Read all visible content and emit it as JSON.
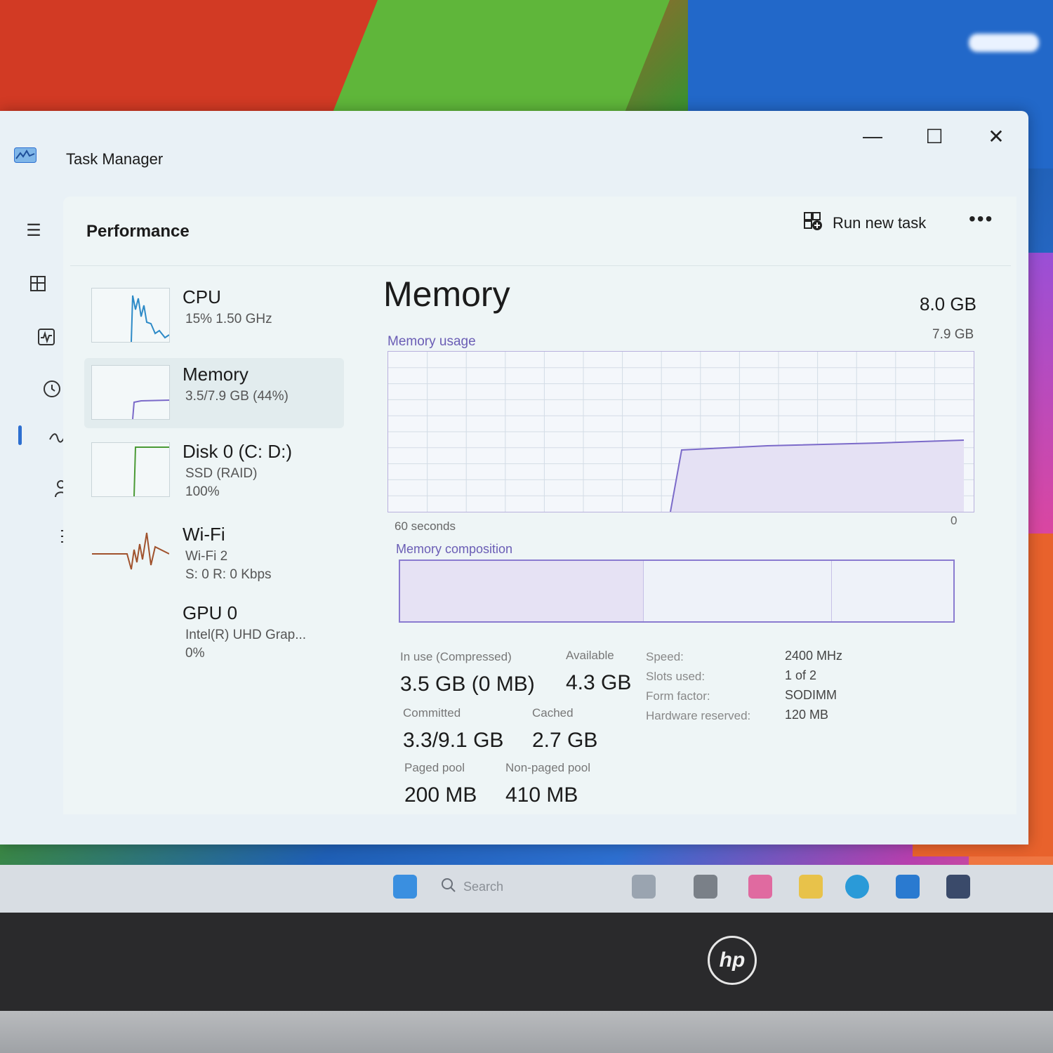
{
  "window": {
    "title": "Task Manager",
    "controls": {
      "minimize": "—",
      "maximize": "☐",
      "close": "✕"
    }
  },
  "header": {
    "title": "Performance",
    "run_task_label": "Run new task",
    "more_label": "•••"
  },
  "nav": {
    "items": [
      "hamburger-menu-icon",
      "processes-icon",
      "performance-icon",
      "app-history-icon",
      "startup-apps-icon",
      "users-icon",
      "details-icon",
      "services-icon"
    ]
  },
  "resources": [
    {
      "name": "CPU",
      "line1": "15% 1.50 GHz",
      "line2": "",
      "line3": "",
      "color": "#2d8ac7"
    },
    {
      "name": "Memory",
      "line1": "3.5/7.9 GB (44%)",
      "line2": "",
      "line3": "",
      "color": "#7b6ac9"
    },
    {
      "name": "Disk 0 (C: D:)",
      "line1": "SSD (RAID)",
      "line2": "100%",
      "line3": "",
      "color": "#4a9a35"
    },
    {
      "name": "Wi-Fi",
      "line1": "Wi-Fi 2",
      "line2": "S: 0 R: 0 Kbps",
      "line3": "",
      "color": "#a0522d"
    },
    {
      "name": "GPU 0",
      "line1": "Intel(R) UHD Grap...",
      "line2": "0%",
      "line3": "",
      "color": "#2d8ac7"
    }
  ],
  "memory": {
    "title": "Memory",
    "total": "8.0 GB",
    "usage_label": "Memory usage",
    "max_label": "7.9 GB",
    "time_left": "60 seconds",
    "time_right": "0",
    "composition_label": "Memory composition",
    "composition": [
      0.44,
      0.34,
      0.22
    ],
    "line_color": "#7b6ac9",
    "stats": {
      "in_use_label": "In use (Compressed)",
      "in_use_value": "3.5 GB (0 MB)",
      "available_label": "Available",
      "available_value": "4.3 GB",
      "committed_label": "Committed",
      "committed_value": "3.3/9.1 GB",
      "cached_label": "Cached",
      "cached_value": "2.7 GB",
      "paged_label": "Paged pool",
      "paged_value": "200 MB",
      "nonpaged_label": "Non-paged pool",
      "nonpaged_value": "410 MB"
    },
    "specs": [
      {
        "label": "Speed:",
        "value": "2400 MHz"
      },
      {
        "label": "Slots used:",
        "value": "1 of 2"
      },
      {
        "label": "Form factor:",
        "value": "SODIMM"
      },
      {
        "label": "Hardware reserved:",
        "value": "120 MB"
      }
    ]
  },
  "taskbar": {
    "search_placeholder": "Search"
  },
  "brand": {
    "logo": "hp"
  }
}
